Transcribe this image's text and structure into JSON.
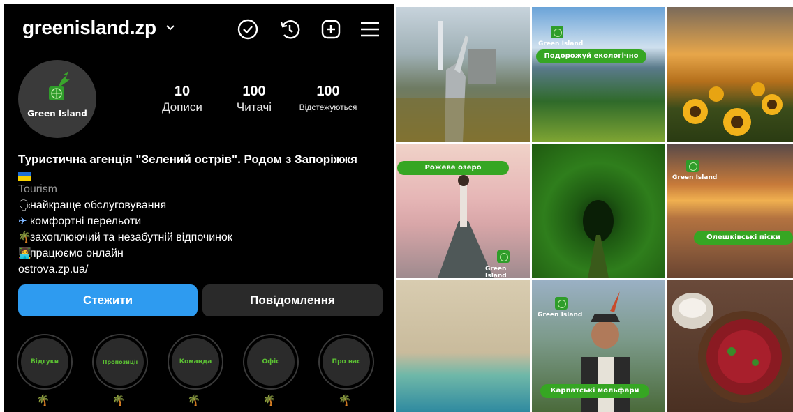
{
  "profile": {
    "username": "greenisland.zp",
    "avatar_text": "Green Island",
    "stats": [
      {
        "value": "10",
        "label": "Дописи"
      },
      {
        "value": "100",
        "label": "Читачі"
      },
      {
        "value": "100",
        "label": "Відстежуються"
      }
    ],
    "bio": {
      "name": "Туристична агенція \"Зелений острів\". Родом з Запоріжжя",
      "category": "Tourism",
      "lines": [
        {
          "emoji": "🗣",
          "text": "найкраще обслуговування"
        },
        {
          "emoji": "✈",
          "text": "комфортні перельоти"
        },
        {
          "emoji": "🌴",
          "text": "захоплюючий та незабутній відпочинок"
        },
        {
          "emoji": "👩‍💻",
          "text": "працюємо онлайн"
        }
      ],
      "link": "ostrova.zp.ua/"
    },
    "follow_label": "Стежити",
    "message_label": "Повідомлення",
    "highlights": [
      "Відгуки",
      "Пропозиції",
      "Команда",
      "Офіс",
      "Про нас"
    ],
    "highlight_emoji": "🌴"
  },
  "grid": {
    "tiles": [
      {
        "id": "kyiv",
        "text": ""
      },
      {
        "id": "eco",
        "text": "Подорожуй екологічно",
        "brand": "Green Island"
      },
      {
        "id": "sunflowers",
        "text": ""
      },
      {
        "id": "pink-lake",
        "text": "Рожеве озеро",
        "brand": "Green Island"
      },
      {
        "id": "tunnel",
        "text": ""
      },
      {
        "id": "sands",
        "text": "Олешківські піски",
        "brand": "Green Island"
      },
      {
        "id": "beach",
        "text": ""
      },
      {
        "id": "molfar",
        "text": "Карпатські мольфари",
        "brand": "Green Island"
      },
      {
        "id": "borscht",
        "text": ""
      }
    ]
  },
  "colors": {
    "accent": "#2e9bf0",
    "brand_green": "#36a623",
    "background": "#000000"
  }
}
